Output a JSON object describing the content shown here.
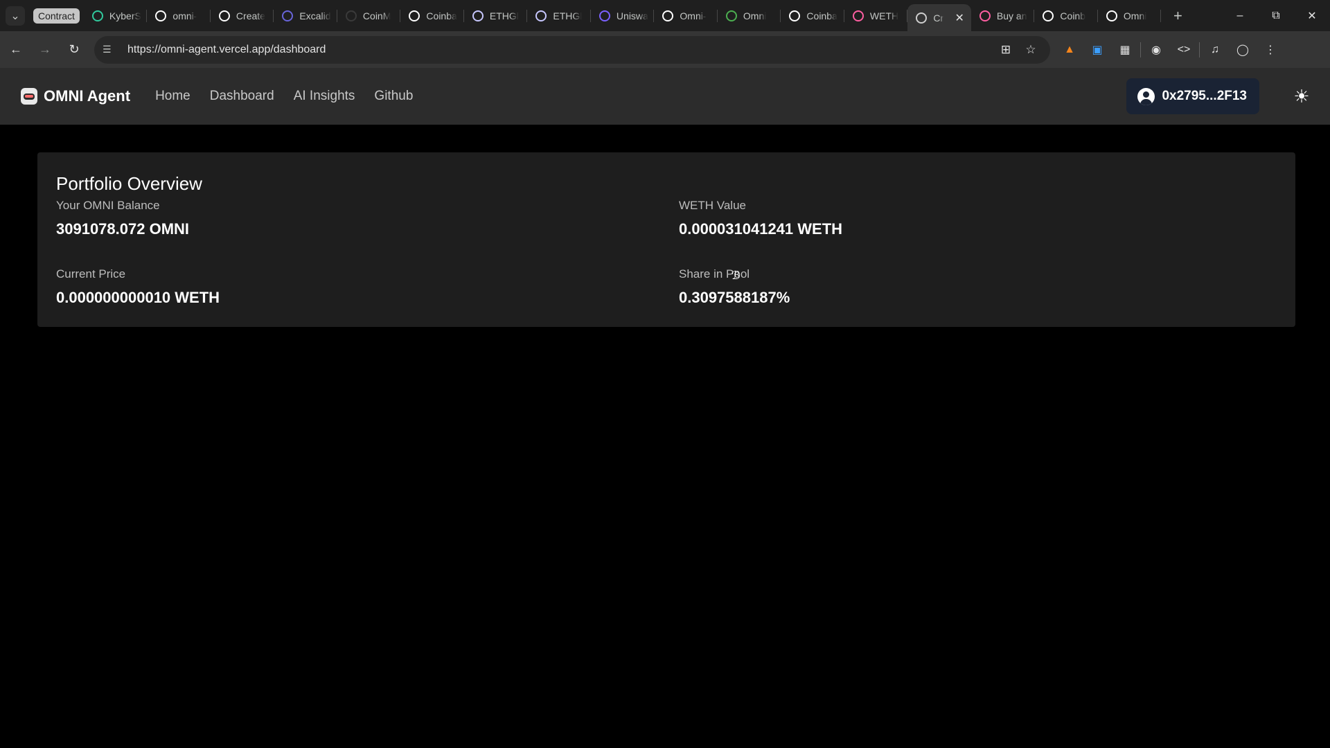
{
  "browser": {
    "tab_group_label": "Contract",
    "tabs": [
      {
        "title": "KyberS",
        "icon": "kyber-icon",
        "color": "#31cb9e"
      },
      {
        "title": "omni-",
        "icon": "vercel-icon",
        "color": "#ffffff"
      },
      {
        "title": "Create",
        "icon": "vercel-icon",
        "color": "#ffffff"
      },
      {
        "title": "Excalid",
        "icon": "excalidraw-icon",
        "color": "#6965db"
      },
      {
        "title": "CoinM",
        "icon": "coinmarketcap-icon",
        "color": "#3a3a3a"
      },
      {
        "title": "Coinba",
        "icon": "coinbase-icon",
        "color": "#ffffff"
      },
      {
        "title": "ETHGl",
        "icon": "ethglobal-icon",
        "color": "#c8c8ff"
      },
      {
        "title": "ETHGl",
        "icon": "ethglobal-icon",
        "color": "#c8c8ff"
      },
      {
        "title": "Uniswa",
        "icon": "uniswap-icon",
        "color": "#7b61ff"
      },
      {
        "title": "Omni-",
        "icon": "github-icon",
        "color": "#ffffff"
      },
      {
        "title": "Omni",
        "icon": "omni-icon",
        "color": "#4caf50"
      },
      {
        "title": "Coinba",
        "icon": "coinbase-icon",
        "color": "#ffffff"
      },
      {
        "title": "WETH",
        "icon": "weth-icon",
        "color": "#ff5fa2"
      },
      {
        "title": "Cr",
        "icon": "openai-icon",
        "color": "#cfcfcf",
        "active": true
      },
      {
        "title": "Buy an",
        "icon": "uniswap-pink-icon",
        "color": "#ff5fa2"
      },
      {
        "title": "Coinb",
        "icon": "coinbase-icon",
        "color": "#ffffff"
      },
      {
        "title": "Omni",
        "icon": "github-icon",
        "color": "#ffffff"
      }
    ],
    "url": "https://omni-agent.vercel.app/dashboard"
  },
  "header": {
    "brand": "OMNI Agent",
    "nav": [
      "Home",
      "Dashboard",
      "AI Insights",
      "Github"
    ],
    "wallet_address": "0x2795...2F13"
  },
  "portfolio": {
    "title": "Portfolio Overview",
    "balance_label": "Your OMNI Balance",
    "balance_value": "3091078.072 OMNI",
    "weth_label": "WETH Value",
    "weth_value": "0.000031041241 WETH",
    "price_label": "Current Price",
    "price_value": "0.000000000010 WETH",
    "share_label": "Share in Pool",
    "share_value": "0.3097588187%"
  },
  "colors": {
    "page_bg": "#000000",
    "header_bg": "#2c2c2c",
    "card_bg": "#1e1e1e",
    "wallet_bg": "#1a2334"
  }
}
